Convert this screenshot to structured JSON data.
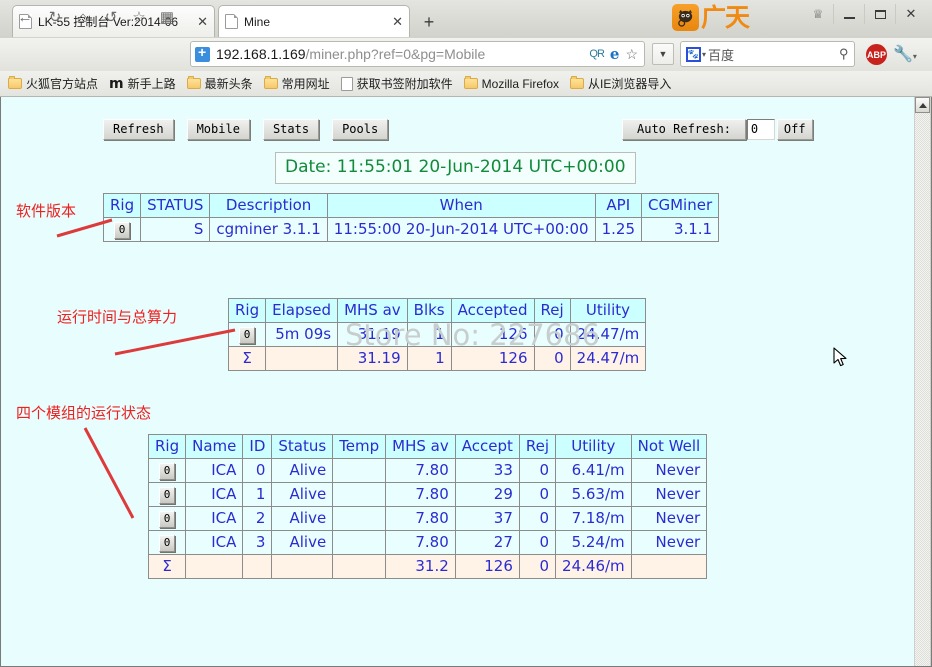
{
  "browser": {
    "tabs": [
      {
        "title": "LK-55 控制台 Ver:2014-06",
        "close": "✕",
        "favicon": "page-icon"
      },
      {
        "title": "Mine",
        "close": "✕",
        "favicon": "page-icon"
      }
    ],
    "new_tab_label": "+",
    "window_buttons": {
      "shirt": "♕",
      "minimize": "—",
      "maximize": "❐",
      "close": "✕"
    },
    "brand": {
      "text": "广天",
      "badge": "cat-logo"
    },
    "nav_icons": {
      "back": "←",
      "forward": "→",
      "home": "⌂",
      "reload": "↻",
      "bookmark": "☆",
      "grid": "▦"
    },
    "url": {
      "host": "192.168.1.169",
      "path": "/miner.php?ref=0&pg=Mobile"
    },
    "url_icons": {
      "qr": "QR",
      "e": "e",
      "star": "☆",
      "caret": "▼"
    },
    "search": {
      "engine": "baidu-icon",
      "placeholder": "百度",
      "value": "百度",
      "magnifier": "⚲",
      "caret": "▾"
    },
    "extensions": {
      "adblock": "ABP",
      "wrench": "🔧"
    },
    "bookmarks": [
      {
        "label": "火狐官方站点",
        "icon": "folder-icon"
      },
      {
        "label": "新手上路",
        "icon": "m-icon"
      },
      {
        "label": "最新头条",
        "icon": "folder-icon"
      },
      {
        "label": "常用网址",
        "icon": "folder-icon"
      },
      {
        "label": "获取书签附加软件",
        "icon": "page-icon"
      },
      {
        "label": "Mozilla Firefox",
        "icon": "folder-icon"
      },
      {
        "label": "从IE浏览器导入",
        "icon": "folder-icon"
      }
    ]
  },
  "page": {
    "toolbar_buttons": [
      "Refresh",
      "Mobile",
      "Stats",
      "Pools"
    ],
    "auto_refresh": {
      "label": "Auto Refresh:",
      "value": "0",
      "toggle": "Off"
    },
    "date": "Date: 11:55:01 20-Jun-2014 UTC+00:00",
    "watermark": "Store No: 227686",
    "status_table": {
      "headers": [
        "Rig",
        "STATUS",
        "Description",
        "When",
        "API",
        "CGMiner"
      ],
      "rows": [
        {
          "rig": "0",
          "status": "S",
          "description": "cgminer 3.1.1",
          "when": "11:55:00 20-Jun-2014 UTC+00:00",
          "api": "1.25",
          "cgminer": "3.1.1"
        }
      ]
    },
    "summary_table": {
      "headers": [
        "Rig",
        "Elapsed",
        "MHS av",
        "Blks",
        "Accepted",
        "Rej",
        "Utility"
      ],
      "rows": [
        {
          "rig": "0",
          "elapsed": "5m 09s",
          "mhs_av": "31.19",
          "blks": "1",
          "accepted": "126",
          "rej": "0",
          "utility": "24.47/m"
        }
      ],
      "total": {
        "rig": "Σ",
        "elapsed": "",
        "mhs_av": "31.19",
        "blks": "1",
        "accepted": "126",
        "rej": "0",
        "utility": "24.47/m"
      }
    },
    "devices_table": {
      "headers": [
        "Rig",
        "Name",
        "ID",
        "Status",
        "Temp",
        "MHS av",
        "Accept",
        "Rej",
        "Utility",
        "Not Well"
      ],
      "rows": [
        {
          "rig": "0",
          "name": "ICA",
          "id": "0",
          "status": "Alive",
          "temp": "",
          "mhs_av": "7.80",
          "accept": "33",
          "rej": "0",
          "utility": "6.41/m",
          "not_well": "Never"
        },
        {
          "rig": "0",
          "name": "ICA",
          "id": "1",
          "status": "Alive",
          "temp": "",
          "mhs_av": "7.80",
          "accept": "29",
          "rej": "0",
          "utility": "5.63/m",
          "not_well": "Never"
        },
        {
          "rig": "0",
          "name": "ICA",
          "id": "2",
          "status": "Alive",
          "temp": "",
          "mhs_av": "7.80",
          "accept": "37",
          "rej": "0",
          "utility": "7.18/m",
          "not_well": "Never"
        },
        {
          "rig": "0",
          "name": "ICA",
          "id": "3",
          "status": "Alive",
          "temp": "",
          "mhs_av": "7.80",
          "accept": "27",
          "rej": "0",
          "utility": "5.24/m",
          "not_well": "Never"
        }
      ],
      "total": {
        "rig": "Σ",
        "name": "",
        "id": "",
        "status": "",
        "temp": "",
        "mhs_av": "31.2",
        "accept": "126",
        "rej": "0",
        "utility": "24.46/m",
        "not_well": ""
      }
    }
  },
  "annotations": [
    {
      "text": "软件版本",
      "color": "#ee2020"
    },
    {
      "text": "运行时间与总算力",
      "color": "#ee2020"
    },
    {
      "text": "四个模组的运行状态",
      "color": "#ee2020"
    }
  ],
  "colors": {
    "header_bg": "#ccffff",
    "cell_bg": "#e9ffff",
    "total_bg": "#fff3e8",
    "text_blue": "#2b2bd0",
    "date_green": "#118a3a",
    "annotation_red": "#ee2020",
    "page_bg": "#e8fdfd"
  }
}
